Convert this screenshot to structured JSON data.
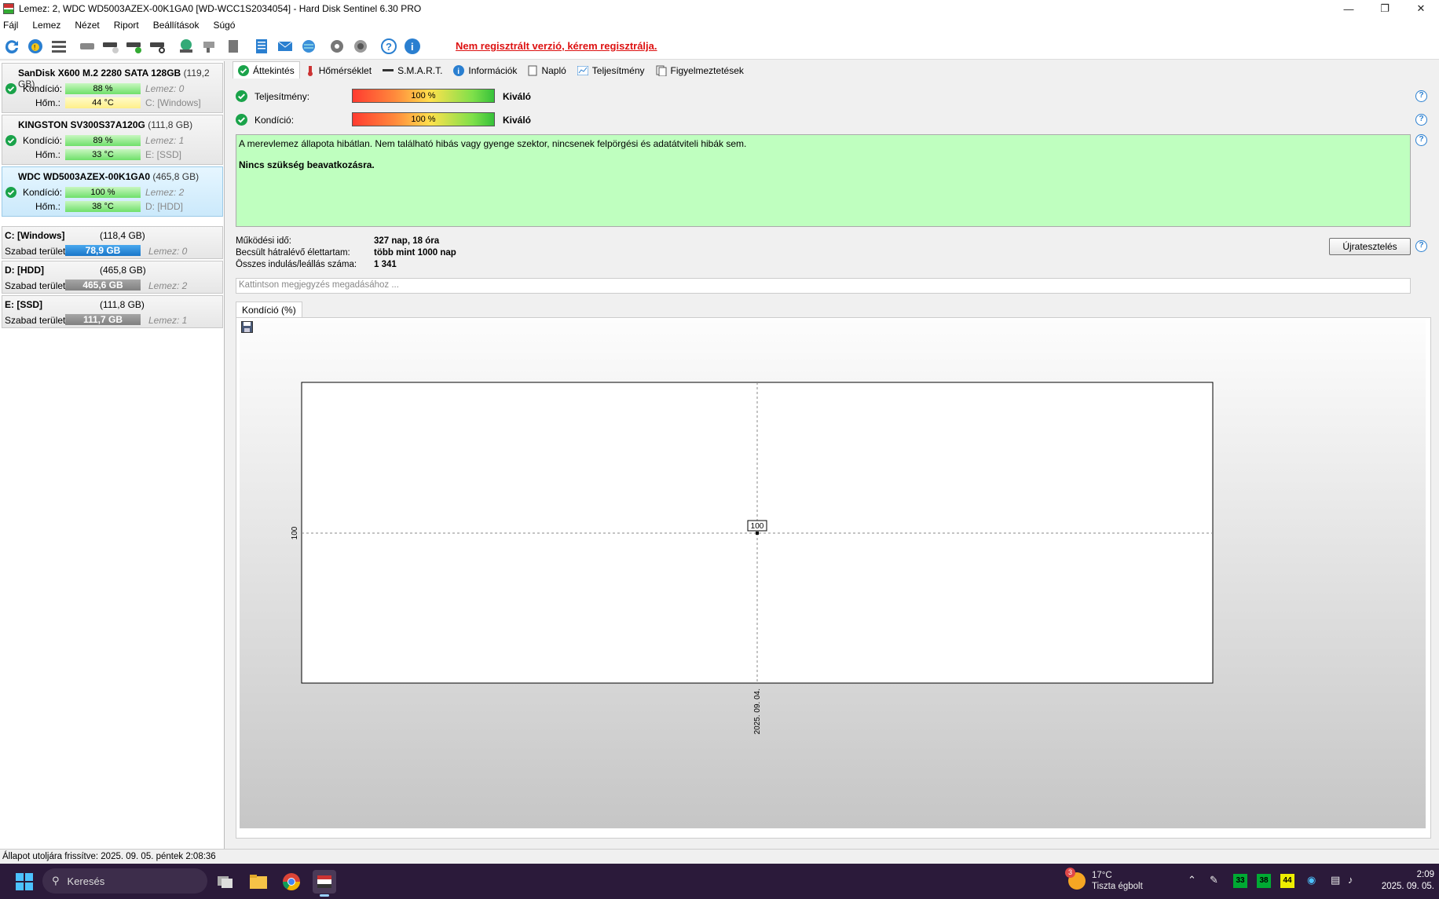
{
  "window": {
    "title": "Lemez: 2, WDC WD5003AZEX-00K1GA0 [WD-WCC1S2034054]  -  Hard Disk Sentinel 6.30 PRO"
  },
  "menu": [
    "Fájl",
    "Lemez",
    "Nézet",
    "Riport",
    "Beállítások",
    "Súgó"
  ],
  "toolbar": {
    "register_link": "Nem regisztrált verzió, kérem regisztrálja."
  },
  "disks": [
    {
      "name": "SanDisk X600 M.2 2280 SATA 128GB",
      "size": "(119,2 GB)",
      "condition_label": "Kondíció:",
      "condition": "88 %",
      "condition_value": 0.88,
      "disk_no": "Lemez: 0",
      "temp_label": "Hőm.:",
      "temp": "44 °C",
      "volume": "C: [Windows]"
    },
    {
      "name": "KINGSTON SV300S37A120G",
      "size": "(111,8 GB)",
      "condition_label": "Kondíció:",
      "condition": "89 %",
      "condition_value": 0.89,
      "disk_no": "Lemez: 1",
      "temp_label": "Hőm.:",
      "temp": "33 °C",
      "volume": "E: [SSD]"
    },
    {
      "name": "WDC WD5003AZEX-00K1GA0",
      "size": "(465,8 GB)",
      "condition_label": "Kondíció:",
      "condition": "100 %",
      "condition_value": 1.0,
      "disk_no": "Lemez: 2",
      "temp_label": "Hőm.:",
      "temp": "38 °C",
      "volume": "D: [HDD]"
    }
  ],
  "partitions": [
    {
      "name": "C: [Windows]",
      "size": "(118,4 GB)",
      "free_label": "Szabad terület",
      "free": "78,9 GB",
      "disk": "Lemez: 0"
    },
    {
      "name": "D: [HDD]",
      "size": "(465,8 GB)",
      "free_label": "Szabad terület",
      "free": "465,6 GB",
      "disk": "Lemez: 2"
    },
    {
      "name": "E: [SSD]",
      "size": "(111,8 GB)",
      "free_label": "Szabad terület",
      "free": "111,7 GB",
      "disk": "Lemez: 1"
    }
  ],
  "tabs": [
    "Áttekintés",
    "Hőmérséklet",
    "S.M.A.R.T.",
    "Információk",
    "Napló",
    "Teljesítmény",
    "Figyelmeztetések"
  ],
  "overview": {
    "performance_label": "Teljesítmény:",
    "performance": "100 %",
    "performance_value": 1.0,
    "performance_rating": "Kiváló",
    "condition_label": "Kondíció:",
    "condition": "100 %",
    "condition_value": 1.0,
    "condition_rating": "Kiváló",
    "message": "A merevlemez állapota hibátlan. Nem található hibás vagy gyenge szektor, nincsenek felpörgési és adatátviteli hibák sem.",
    "action": "Nincs szükség beavatkozásra.",
    "uptime_label": "Működési idő:",
    "uptime": "327 nap, 18 óra",
    "remaining_label": "Becsült hátralévő élettartam:",
    "remaining": "több mint 1000 nap",
    "starts_label": "Összes indulás/leállás száma:",
    "starts": "1 341",
    "retest_button": "Újratesztelés",
    "note_placeholder": "Kattintson megjegyzés megadásához ..."
  },
  "graph": {
    "tab_label": "Kondíció  (%)"
  },
  "chart_data": {
    "type": "line",
    "x": [
      "2025. 09. 04."
    ],
    "series": [
      {
        "values": [
          100
        ]
      }
    ],
    "data_labels": [
      "100"
    ],
    "ylabel": "",
    "xlabel": "",
    "y_tick_labels": [
      "100"
    ],
    "x_tick_labels": [
      "2025. 09. 04."
    ],
    "grid": "dashed crosshair",
    "colors": {
      "plot_bg": "#ffffff",
      "frame": "#000000"
    }
  },
  "statusbar": {
    "text": "Állapot utoljára frissítve: 2025. 09. 05. péntek 2:08:36"
  },
  "taskbar": {
    "search_label": "Keresés",
    "weather_temp": "17°C",
    "weather_desc": "Tiszta égbolt",
    "weather_badge": "3",
    "tray_temps": [
      "33",
      "38",
      "44"
    ],
    "time": "2:09",
    "date": "2025. 09. 05."
  }
}
